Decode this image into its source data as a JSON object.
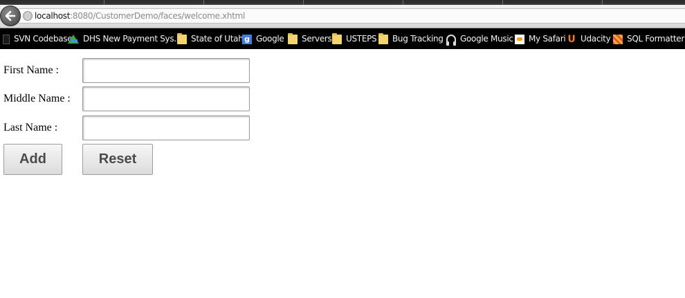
{
  "browser": {
    "url_host": "localhost",
    "url_path": ":8080/CustomerDemo/faces/welcome.xhtml",
    "bookmarks": [
      {
        "label": "SVN Codebase",
        "icon": "blank-page-icon"
      },
      {
        "label": "DHS New Payment Sys...",
        "icon": "google-drive-icon"
      },
      {
        "label": "State of Utah",
        "icon": "folder-icon"
      },
      {
        "label": "Google",
        "icon": "google-icon"
      },
      {
        "label": "Servers",
        "icon": "folder-icon"
      },
      {
        "label": "USTEPS",
        "icon": "folder-icon"
      },
      {
        "label": "Bug Tracking",
        "icon": "folder-icon"
      },
      {
        "label": "Google Music",
        "icon": "headphones-icon"
      },
      {
        "label": "My Safari",
        "icon": "safari-books-icon"
      },
      {
        "label": "Udacity",
        "icon": "udacity-icon"
      },
      {
        "label": "SQL Formatter",
        "icon": "sql-formatter-icon"
      }
    ]
  },
  "form": {
    "first_name_label": "First Name :",
    "middle_name_label": "Middle Name :",
    "last_name_label": "Last Name :",
    "first_name_value": "",
    "middle_name_value": "",
    "last_name_value": "",
    "add_label": "Add",
    "reset_label": "Reset"
  }
}
